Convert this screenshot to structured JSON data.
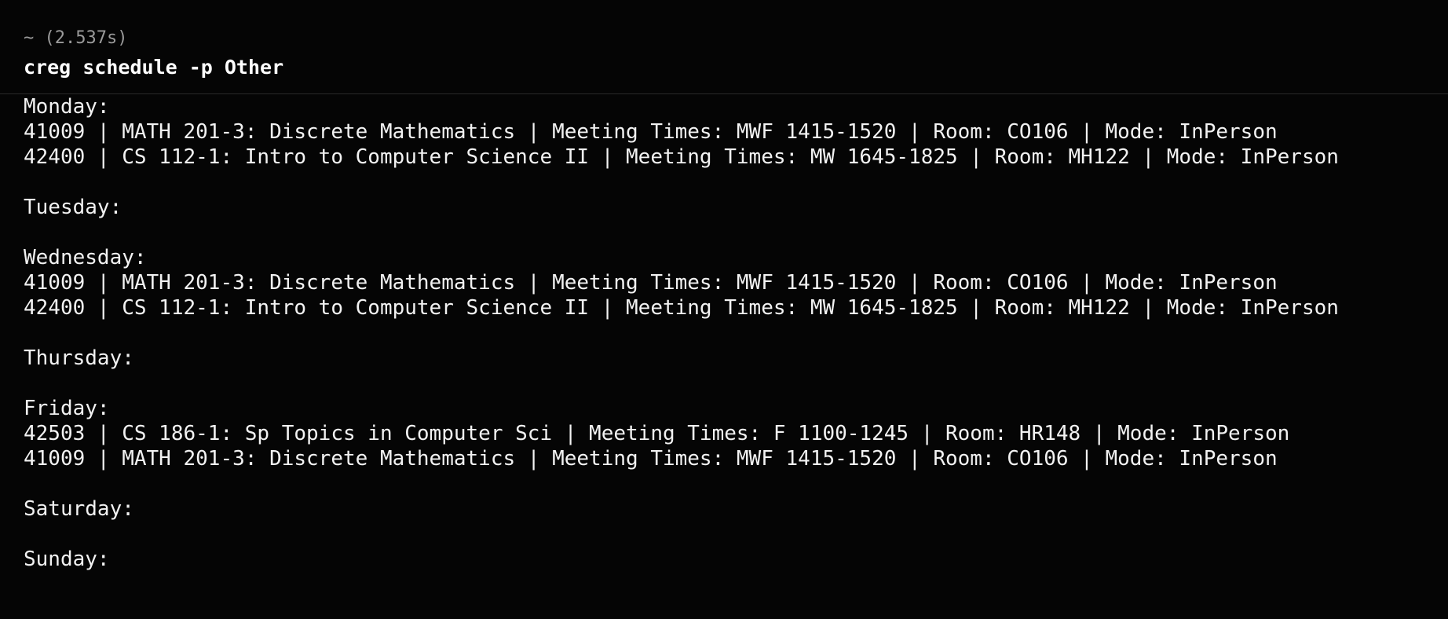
{
  "prompt": {
    "meta": "~ (2.537s)",
    "command": "creg schedule -p Other"
  },
  "schedule": [
    {
      "day": "Monday:",
      "entries": [
        "41009 | MATH 201-3: Discrete Mathematics | Meeting Times: MWF 1415-1520 | Room: CO106 | Mode: InPerson",
        "42400 | CS 112-1: Intro to Computer Science II | Meeting Times: MW 1645-1825 | Room: MH122 | Mode: InPerson"
      ]
    },
    {
      "day": "Tuesday:",
      "entries": []
    },
    {
      "day": "Wednesday:",
      "entries": [
        "41009 | MATH 201-3: Discrete Mathematics | Meeting Times: MWF 1415-1520 | Room: CO106 | Mode: InPerson",
        "42400 | CS 112-1: Intro to Computer Science II | Meeting Times: MW 1645-1825 | Room: MH122 | Mode: InPerson"
      ]
    },
    {
      "day": "Thursday:",
      "entries": []
    },
    {
      "day": "Friday:",
      "entries": [
        "42503 | CS 186-1: Sp Topics in Computer Sci | Meeting Times: F 1100-1245 | Room: HR148 | Mode: InPerson",
        "41009 | MATH 201-3: Discrete Mathematics | Meeting Times: MWF 1415-1520 | Room: CO106 | Mode: InPerson"
      ]
    },
    {
      "day": "Saturday:",
      "entries": []
    },
    {
      "day": "Sunday:",
      "entries": []
    }
  ]
}
